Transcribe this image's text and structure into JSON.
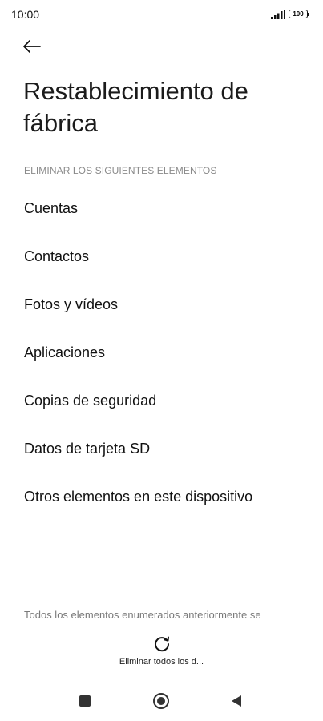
{
  "status_bar": {
    "time": "10:00",
    "battery": "100",
    "icons": [
      "signal-icon",
      "battery-icon"
    ]
  },
  "header": {
    "back_icon": "back-arrow-icon",
    "title": "Restablecimiento de fábrica"
  },
  "section": {
    "header": "ELIMINAR LOS SIGUIENTES ELEMENTOS",
    "items": [
      {
        "label": "Cuentas"
      },
      {
        "label": "Contactos"
      },
      {
        "label": "Fotos y vídeos"
      },
      {
        "label": "Aplicaciones"
      },
      {
        "label": "Copias de seguridad"
      },
      {
        "label": "Datos de tarjeta SD"
      },
      {
        "label": "Otros elementos en este dispositivo"
      }
    ]
  },
  "footer": {
    "text": "Todos los elementos enumerados anteriormente se",
    "spinner_icon": "loading-spinner-icon",
    "progress_label": "Eliminar todos los d..."
  },
  "nav_bar": {
    "icons": [
      "recents-square-icon",
      "home-circle-icon",
      "back-triangle-icon"
    ]
  },
  "colors": {
    "background": "#ffffff",
    "text_primary": "#111111",
    "text_secondary": "#8a8a8a"
  }
}
